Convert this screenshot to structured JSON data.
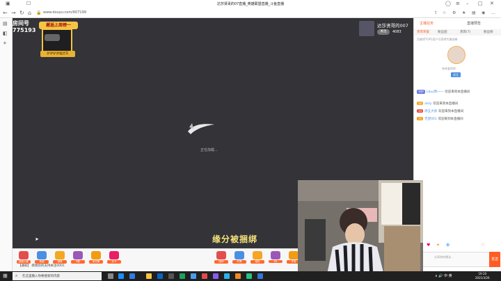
{
  "window": {
    "title": "达莎贤哥的07直播_英雄联盟直播_斗鱼直播"
  },
  "browser": {
    "url": "www.douyu.com/607199"
  },
  "player": {
    "room_label": "房间号",
    "room_id": "775193",
    "badge_top": "邂逅上周榜一",
    "badge_bottom": "驴驴驴驴幽灵车",
    "anchor_name": "达莎贤哥的007",
    "anchor_follow": "关注",
    "anchor_count": "4083",
    "loading_text": "正在加载...",
    "ticker": "缘分被捆绑"
  },
  "gifts": {
    "left": [
      "超级火箭",
      "鱼翅",
      "猫咪",
      "K歌",
      "荧光棒",
      "办卡"
    ],
    "right": [
      "陪伴",
      "开黑",
      "组队",
      "PK",
      "许愿"
    ],
    "notice": "【通知】 感谢您的支持关注0001"
  },
  "right_panel": {
    "tabs_a": [
      "主播任务",
      "直播预告"
    ],
    "tabs_b": [
      "贵宾荣誉",
      "粉丝团",
      "贵宾(7)",
      "粉丝榜"
    ],
    "hint": "贡献榜TOP3用户可获得专属勋章",
    "avatar_name": "亲亲爱的你",
    "follow_btn": "关注",
    "chat": [
      {
        "level": "守护",
        "nick": "Lbuy熊一一",
        "text": "欢迎来到本直播间"
      },
      {
        "level": "12",
        "nick": "alsly",
        "text": "欢迎来到本直播间"
      },
      {
        "level": "14",
        "nick": "周五大侠",
        "text": "欢迎来到本直播间"
      },
      {
        "level": "14",
        "nick": "无望001",
        "text": "欢迎来到本直播间"
      }
    ],
    "input_placeholder": "分享你的想法...",
    "send_label": "发送"
  },
  "taskbar": {
    "search_placeholder": "在这里输入你要搜索的内容",
    "time": "19:10",
    "date": "2021/3/26",
    "tray": "∧ 🔊 中 英"
  },
  "colors": {
    "accent": "#ff5d23",
    "player_bg": "#333338"
  }
}
